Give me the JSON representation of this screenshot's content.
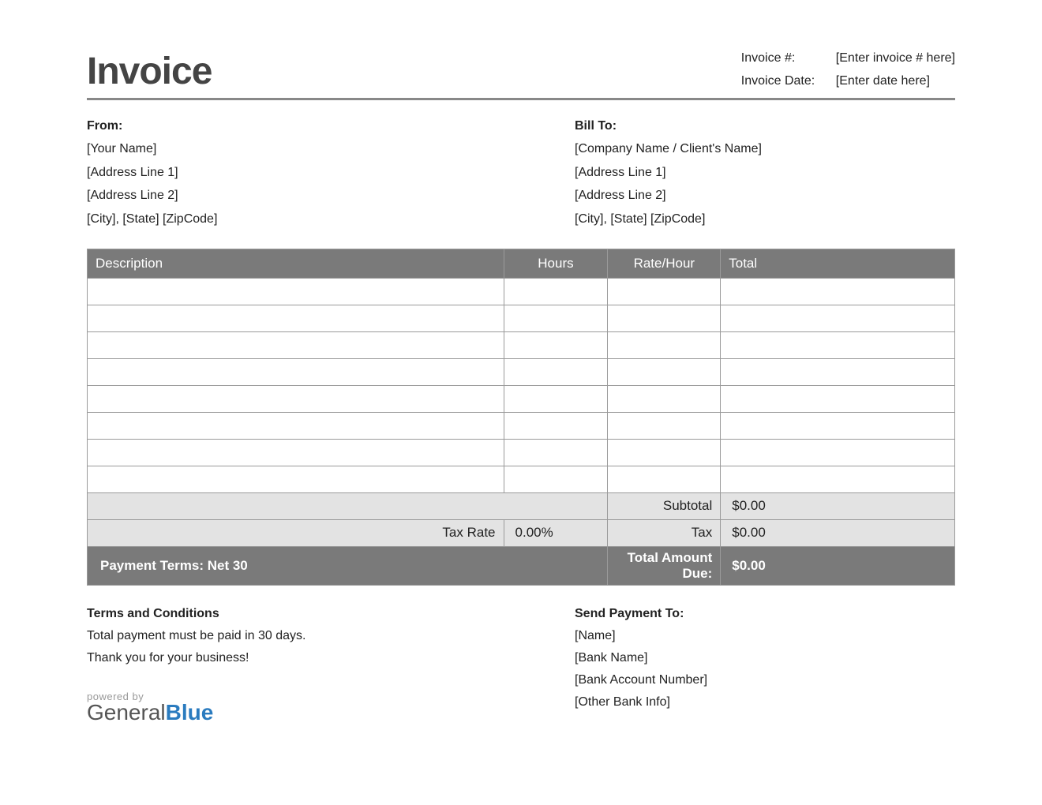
{
  "title": "Invoice",
  "meta": {
    "invoice_number_label": "Invoice #:",
    "invoice_number_value": "[Enter invoice # here]",
    "invoice_date_label": "Invoice Date:",
    "invoice_date_value": "[Enter date here]"
  },
  "from": {
    "heading": "From:",
    "name": "[Your Name]",
    "address1": "[Address Line 1]",
    "address2": "[Address Line 2]",
    "city_state_zip": "[City], [State] [ZipCode]"
  },
  "bill_to": {
    "heading": "Bill To:",
    "name": "[Company Name / Client's Name]",
    "address1": "[Address Line 1]",
    "address2": "[Address Line 2]",
    "city_state_zip": "[City], [State] [ZipCode]"
  },
  "table": {
    "headers": {
      "description": "Description",
      "hours": "Hours",
      "rate": "Rate/Hour",
      "total": "Total"
    },
    "rows": [
      {
        "description": "",
        "hours": "",
        "rate": "",
        "total": ""
      },
      {
        "description": "",
        "hours": "",
        "rate": "",
        "total": ""
      },
      {
        "description": "",
        "hours": "",
        "rate": "",
        "total": ""
      },
      {
        "description": "",
        "hours": "",
        "rate": "",
        "total": ""
      },
      {
        "description": "",
        "hours": "",
        "rate": "",
        "total": ""
      },
      {
        "description": "",
        "hours": "",
        "rate": "",
        "total": ""
      },
      {
        "description": "",
        "hours": "",
        "rate": "",
        "total": ""
      },
      {
        "description": "",
        "hours": "",
        "rate": "",
        "total": ""
      }
    ],
    "subtotal_label": "Subtotal",
    "subtotal_value": "$0.00",
    "tax_rate_label": "Tax Rate",
    "tax_rate_value": "0.00%",
    "tax_label": "Tax",
    "tax_value": "$0.00",
    "payment_terms": "Payment Terms: Net 30",
    "total_due_label": "Total Amount Due:",
    "total_due_value": "$0.00"
  },
  "terms": {
    "heading": "Terms and Conditions",
    "line1": "Total payment must be paid in 30 days.",
    "line2": "Thank you for your business!"
  },
  "payment_to": {
    "heading": "Send Payment To:",
    "name": "[Name]",
    "bank_name": "[Bank Name]",
    "account": "[Bank Account Number]",
    "other": "[Other Bank Info]"
  },
  "branding": {
    "powered_by": "powered by",
    "logo_part1": "General",
    "logo_part2": "Blue"
  }
}
